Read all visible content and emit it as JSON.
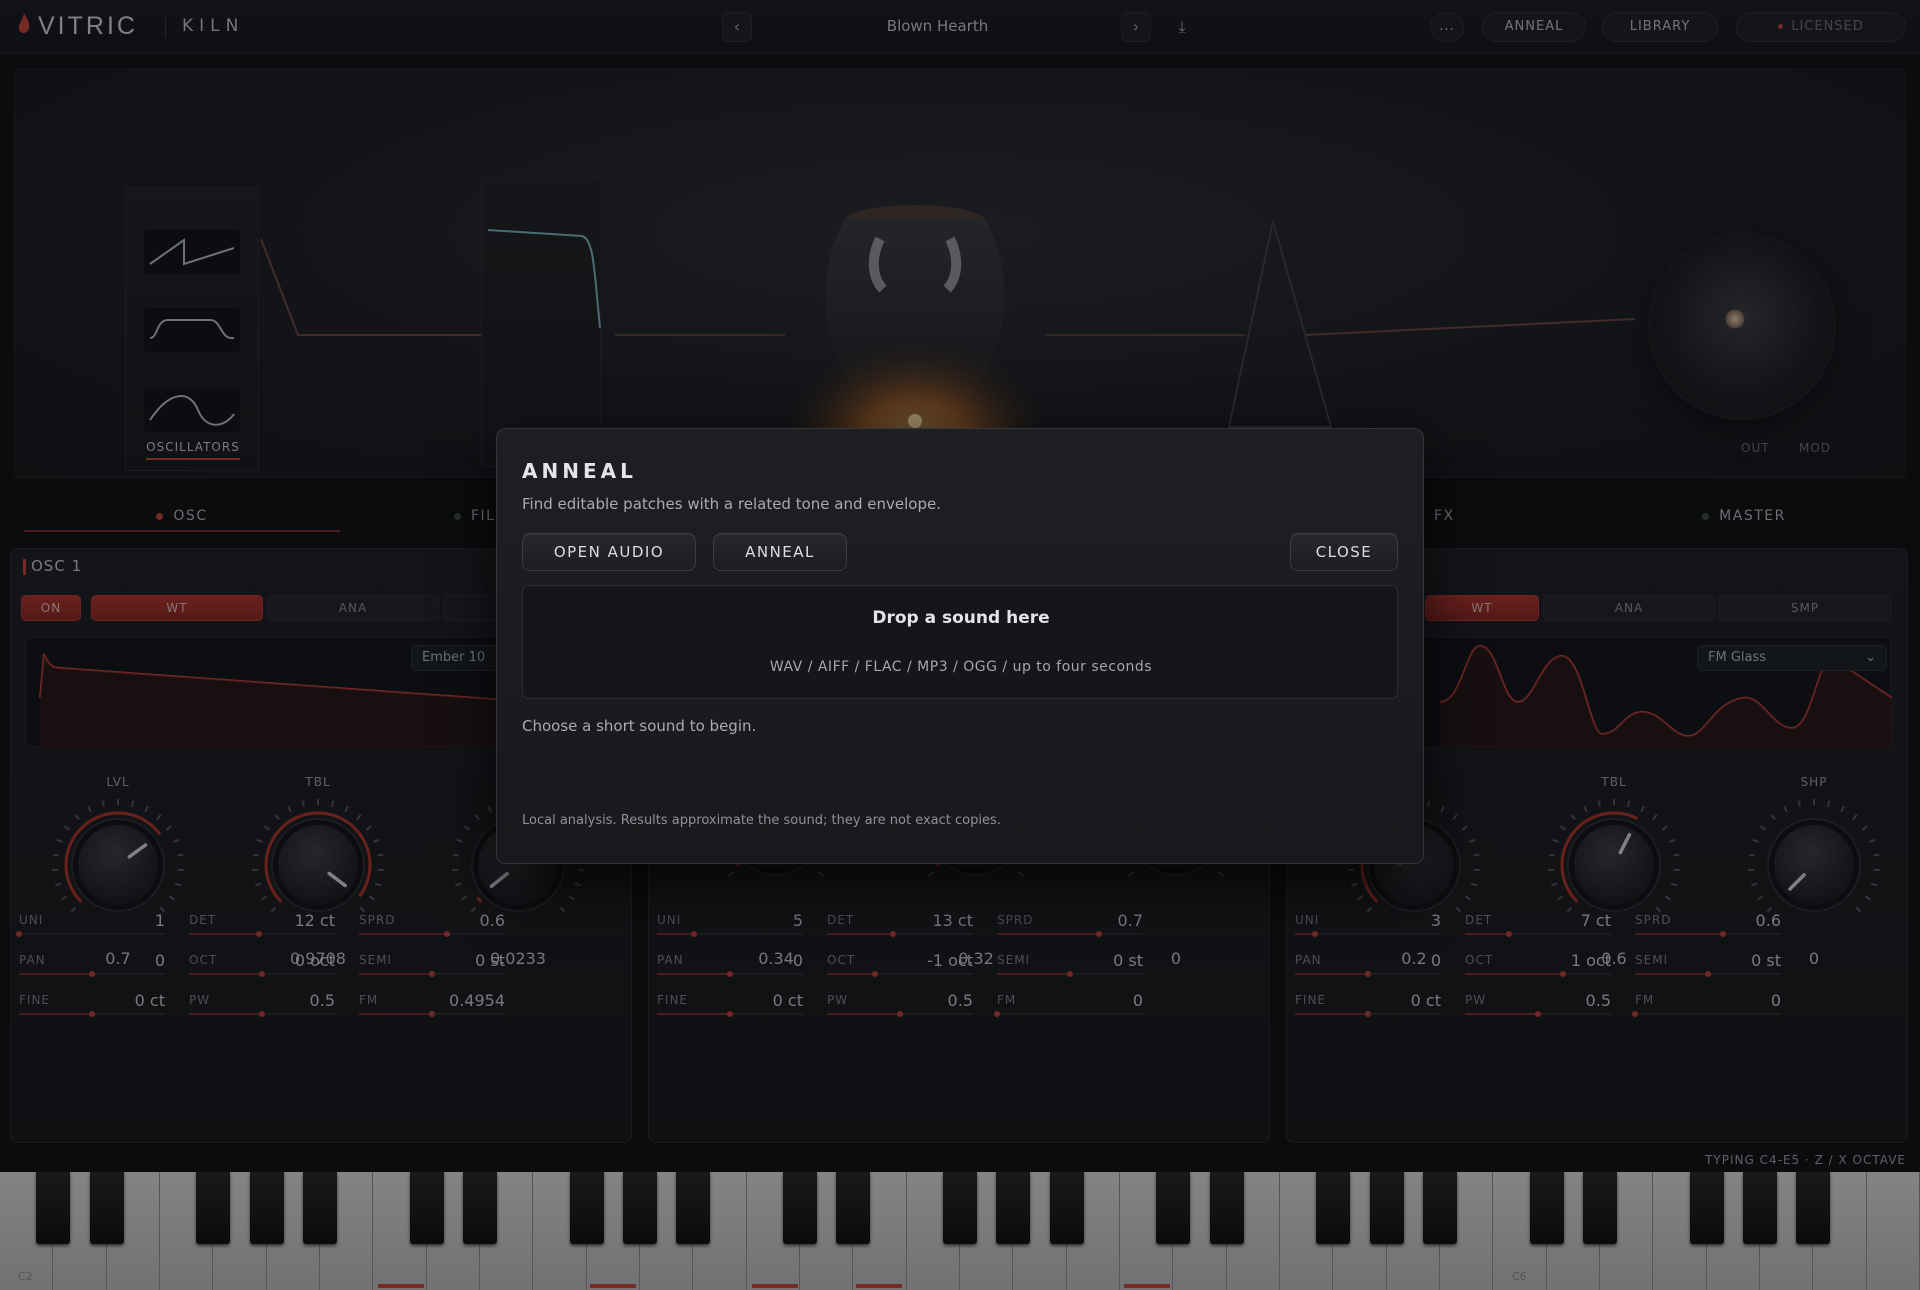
{
  "header": {
    "brand": "VITRIC",
    "product": "KILN",
    "preset_name": "Blown Hearth",
    "prev_icon": "chevron-left-icon",
    "next_icon": "chevron-right-icon",
    "save_icon": "download-icon",
    "more_label": "...",
    "anneal_label": "ANNEAL",
    "library_label": "LIBRARY",
    "license_label": "LICENSED"
  },
  "stage": {
    "oscillators_label": "OSCILLATORS",
    "out_label": "OUT",
    "mod_label": "MOD"
  },
  "tabs": [
    {
      "label": "OSC"
    },
    {
      "label": "FIL"
    },
    {
      "label": "FX"
    },
    {
      "label": "MASTER"
    }
  ],
  "osc1": {
    "title": "OSC 1",
    "on_label": "ON",
    "modes": [
      "WT",
      "ANA"
    ],
    "wavetable": "Ember 10",
    "knobs": [
      {
        "label": "LVL",
        "value": "0.7"
      },
      {
        "label": "TBL",
        "value": "0.9708"
      },
      {
        "label": "",
        "value": "0.0233"
      }
    ],
    "params": [
      {
        "label": "UNI",
        "value": "1",
        "pos": 0.0
      },
      {
        "label": "DET",
        "value": "12 ct",
        "pos": 0.48
      },
      {
        "label": "SPRD",
        "value": "0.6",
        "pos": 0.6
      },
      {
        "label": "PAN",
        "value": "0",
        "pos": 0.5
      },
      {
        "label": "OCT",
        "value": "0 oct",
        "pos": 0.5
      },
      {
        "label": "SEMI",
        "value": "0 st",
        "pos": 0.5
      },
      {
        "label": "FINE",
        "value": "0 ct",
        "pos": 0.5
      },
      {
        "label": "PW",
        "value": "0.5",
        "pos": 0.5
      },
      {
        "label": "FM",
        "value": "0.4954",
        "pos": 0.5
      }
    ]
  },
  "osc2": {
    "knob_values": [
      "0.34",
      "0.32",
      "0"
    ],
    "params": [
      {
        "label": "UNI",
        "value": "5",
        "pos": 0.25
      },
      {
        "label": "DET",
        "value": "13 ct",
        "pos": 0.45
      },
      {
        "label": "SPRD",
        "value": "0.7",
        "pos": 0.7
      },
      {
        "label": "PAN",
        "value": "0",
        "pos": 0.5
      },
      {
        "label": "OCT",
        "value": "-1 oct",
        "pos": 0.33
      },
      {
        "label": "SEMI",
        "value": "0 st",
        "pos": 0.5
      },
      {
        "label": "FINE",
        "value": "0 ct",
        "pos": 0.5
      },
      {
        "label": "PW",
        "value": "0.5",
        "pos": 0.5
      },
      {
        "label": "FM",
        "value": "0",
        "pos": 0.0
      }
    ]
  },
  "osc3": {
    "modes": [
      "WT",
      "ANA",
      "SMP"
    ],
    "wavetable": "FM Glass",
    "knobs": [
      {
        "label": "",
        "value": "0.2"
      },
      {
        "label": "TBL",
        "value": "0.6"
      },
      {
        "label": "SHP",
        "value": "0"
      }
    ],
    "params": [
      {
        "label": "UNI",
        "value": "3",
        "pos": 0.14
      },
      {
        "label": "DET",
        "value": "7 ct",
        "pos": 0.3
      },
      {
        "label": "SPRD",
        "value": "0.6",
        "pos": 0.6
      },
      {
        "label": "PAN",
        "value": "0",
        "pos": 0.5
      },
      {
        "label": "OCT",
        "value": "1 oct",
        "pos": 0.67
      },
      {
        "label": "SEMI",
        "value": "0 st",
        "pos": 0.5
      },
      {
        "label": "FINE",
        "value": "0 ct",
        "pos": 0.5
      },
      {
        "label": "PW",
        "value": "0.5",
        "pos": 0.5
      },
      {
        "label": "FM",
        "value": "0",
        "pos": 0.0
      }
    ]
  },
  "keyboard": {
    "hint": "TYPING C4-E5 · Z / X OCTAVE",
    "first_octave_label": "C2",
    "c6_label": "C6"
  },
  "modal": {
    "title": "ANNEAL",
    "subtitle": "Find editable patches with a related tone and envelope.",
    "open_audio_label": "OPEN AUDIO",
    "anneal_label": "ANNEAL",
    "close_label": "CLOSE",
    "drop_title": "Drop a sound here",
    "drop_formats": "WAV / AIFF / FLAC / MP3 / OGG  /  up to four seconds",
    "status": "Choose a short sound to begin.",
    "note": "Local analysis. Results approximate the sound; they are not exact copies."
  },
  "colors": {
    "accent": "#c8413a",
    "panel": "#1b1c20",
    "background": "#0d0e11"
  }
}
